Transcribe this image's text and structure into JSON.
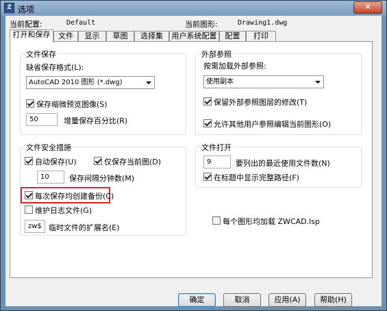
{
  "window": {
    "title": "选项",
    "close_label": "✕"
  },
  "header": {
    "current_profile_label": "当前配置:",
    "current_profile_value": "Default",
    "current_drawing_label": "当前图形:",
    "current_drawing_value": "Drawing1.dwg"
  },
  "tabs": [
    {
      "label": "打开和保存",
      "active": true
    },
    {
      "label": "文件"
    },
    {
      "label": "显示"
    },
    {
      "label": "草图"
    },
    {
      "label": "选择集"
    },
    {
      "label": "用户系统配置"
    },
    {
      "label": "配置"
    },
    {
      "label": "打印"
    }
  ],
  "file_save": {
    "title": "文件保存",
    "format_label": "缺省保存格式(L):",
    "format_value": "AutoCAD 2010 图形 (*.dwg)",
    "thumbnail_label": "保存缩微预览图像(S)",
    "thumbnail_checked": true,
    "incremental_value": "50",
    "incremental_label": "增量保存百分比(R)"
  },
  "xref": {
    "title": "外部参照",
    "load_label": "按需加载外部参照:",
    "load_value": "使用副本",
    "retain_label": "保留外部参照图层的修改(T)",
    "retain_checked": true,
    "allow_edit_label": "允许其他用户参照编辑当前图形(O)",
    "allow_edit_checked": true
  },
  "file_safety": {
    "title": "文件安全措施",
    "autosave_label": "自动保存(U)",
    "autosave_checked": true,
    "save_current_only_label": "仅保存当前图(D)",
    "save_current_only_checked": true,
    "interval_value": "10",
    "interval_label": "保存间隔分钟数(M)",
    "backup_label": "每次保存均创建备份(C)",
    "backup_checked": true,
    "log_label": "维护日志文件(G)",
    "log_checked": false,
    "temp_ext_value": "zw$",
    "temp_ext_label": "临时文件的扩展名(E)"
  },
  "file_open": {
    "title": "文件打开",
    "recent_value": "9",
    "recent_label": "要列出的最近使用文件数(N)",
    "fullpath_label": "在标题中显示完整路径(F)",
    "fullpath_checked": true
  },
  "load_lsp": {
    "label": "每个图形均加载 ZWCAD.lsp",
    "checked": false
  },
  "buttons": {
    "ok": "确定",
    "cancel": "取消",
    "apply": "应用(A)",
    "help": "帮助(H)"
  }
}
